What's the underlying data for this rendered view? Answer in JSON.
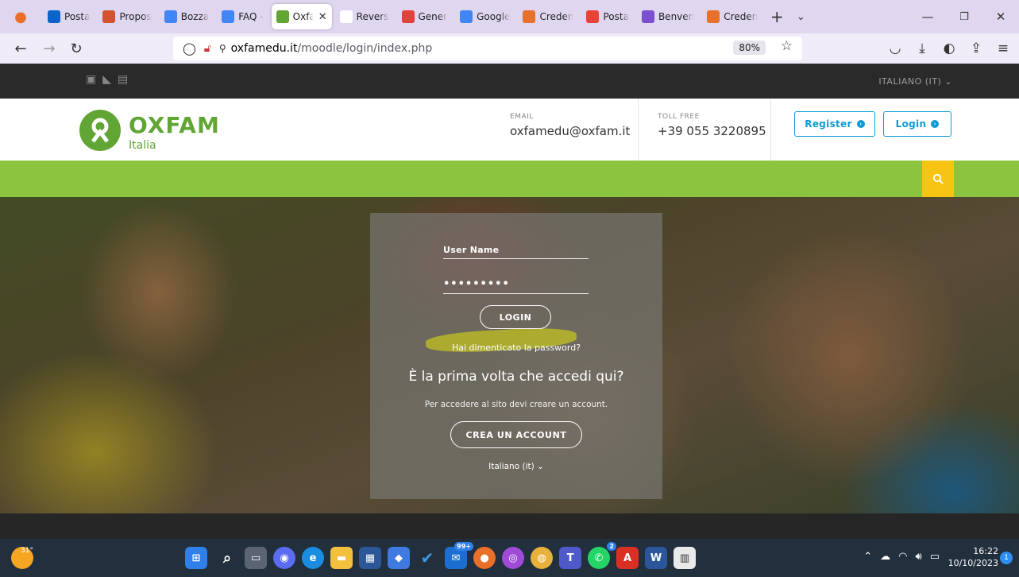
{
  "browser": {
    "tabs": [
      {
        "label": "Posta",
        "color": "#0a64c9",
        "icon": "outlook-icon"
      },
      {
        "label": "Propos",
        "color": "#d35230",
        "icon": "powerpoint-icon"
      },
      {
        "label": "Bozza",
        "color": "#4285f4",
        "icon": "docs-icon"
      },
      {
        "label": "FAQ -",
        "color": "#4285f4",
        "icon": "docs-icon"
      },
      {
        "label": "Oxfa",
        "color": "#61a534",
        "icon": "oxfam-icon",
        "active": true
      },
      {
        "label": "Revers",
        "color": "#ffffff",
        "icon": "blank-icon"
      },
      {
        "label": "Gener",
        "color": "#e0433b",
        "icon": "generator-icon"
      },
      {
        "label": "Google",
        "color": "#4285f4",
        "icon": "google-icon"
      },
      {
        "label": "Creden",
        "color": "#e8702a",
        "icon": "firefox-icon"
      },
      {
        "label": "Posta",
        "color": "#ea4335",
        "icon": "gmail-icon"
      },
      {
        "label": "Benven",
        "color": "#7b4fd0",
        "icon": "benvenuto-icon"
      },
      {
        "label": "Creden",
        "color": "#e8702a",
        "icon": "firefox-icon"
      }
    ],
    "url_domain": "oxfamedu.it",
    "url_path": "/moodle/login/index.php",
    "zoom": "80%"
  },
  "site": {
    "language_top": "ITALIANO (IT) ⌄",
    "brand_name": "OXFAM",
    "brand_sub": "Italia",
    "email_label": "EMAIL",
    "email_value": "oxfamedu@oxfam.it",
    "tollfree_label": "TOLL FREE",
    "tollfree_value": "+39 055 3220895",
    "register_label": "Register",
    "login_label": "Login",
    "accent_green": "#8bc43f",
    "accent_blue": "#0e9bd4",
    "accent_yellow": "#f7c414"
  },
  "login": {
    "username_placeholder": "User Name",
    "password_value": "•••••••••",
    "login_button": "LOGIN",
    "forgot_password": "Hai dimenticato la password?",
    "first_time_heading": "È la prima volta che accedi qui?",
    "need_account": "Per accedere al sito devi creare un account.",
    "create_account_button": "CREA UN ACCOUNT",
    "language_selector": "Italiano (it) ⌄"
  },
  "taskbar": {
    "weather": "31°",
    "mail_badge": "99+",
    "whatsapp_badge": "2",
    "time": "16:22",
    "date": "10/10/2023",
    "notifications": "1"
  }
}
